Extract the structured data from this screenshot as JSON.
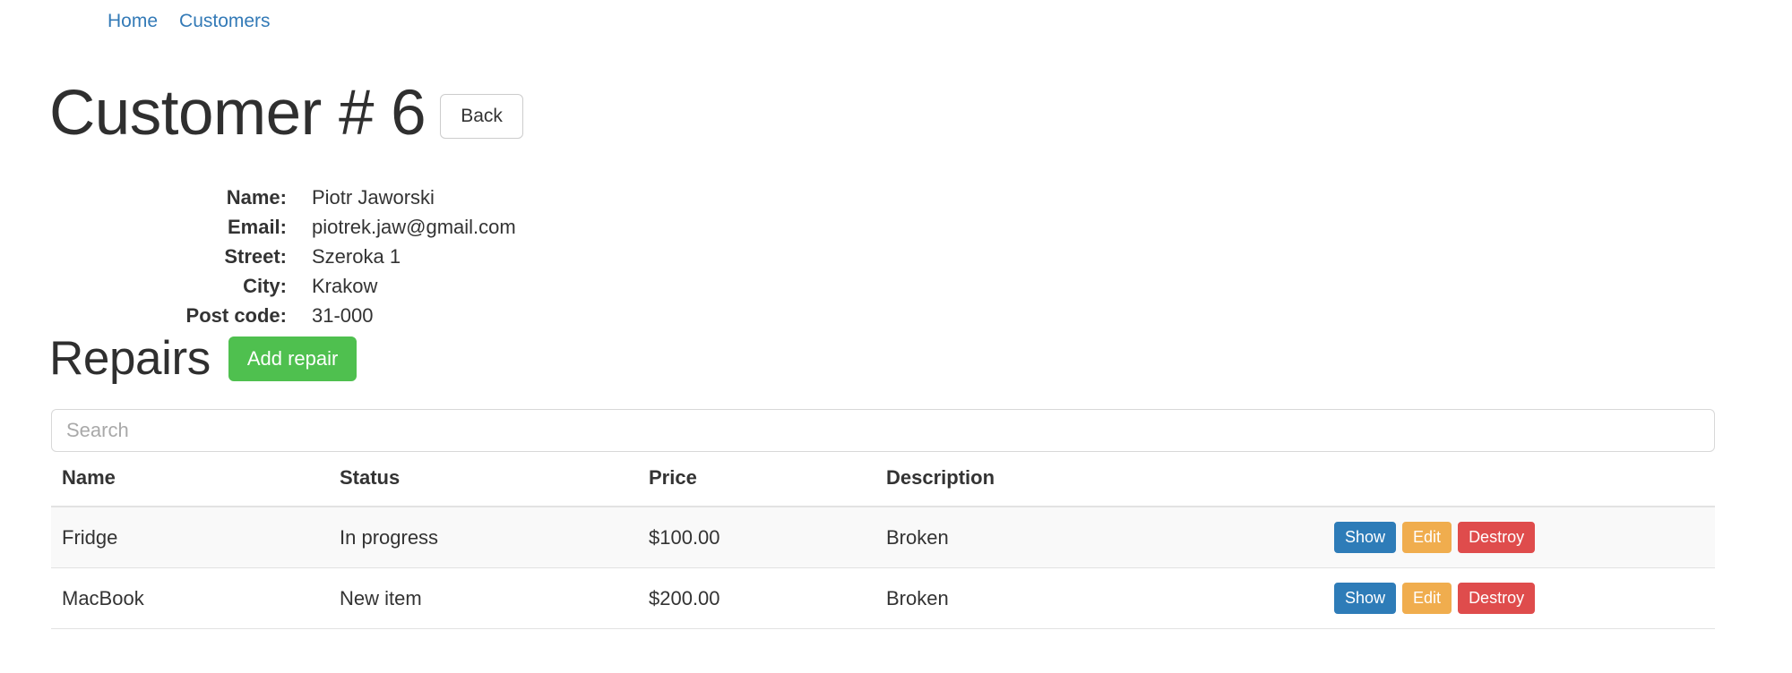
{
  "nav": {
    "links": [
      {
        "label": "Home"
      },
      {
        "label": "Customers"
      }
    ]
  },
  "header": {
    "title": "Customer # 6",
    "back_label": "Back"
  },
  "details": {
    "rows": [
      {
        "term": "Name:",
        "value": "Piotr Jaworski"
      },
      {
        "term": "Email:",
        "value": "piotrek.jaw@gmail.com"
      },
      {
        "term": "Street:",
        "value": "Szeroka 1"
      },
      {
        "term": "City:",
        "value": "Krakow"
      },
      {
        "term": "Post code:",
        "value": "31-000"
      }
    ]
  },
  "repairs": {
    "title": "Repairs",
    "add_label": "Add repair",
    "search": {
      "placeholder": "Search",
      "value": ""
    },
    "columns": [
      {
        "label": "Name"
      },
      {
        "label": "Status"
      },
      {
        "label": "Price"
      },
      {
        "label": "Description"
      },
      {
        "label": ""
      }
    ],
    "rows": [
      {
        "name": "Fridge",
        "status": "In progress",
        "price": "$100.00",
        "description": "Broken",
        "actions": {
          "show": "Show",
          "edit": "Edit",
          "destroy": "Destroy"
        }
      },
      {
        "name": "MacBook",
        "status": "New item",
        "price": "$200.00",
        "description": "Broken",
        "actions": {
          "show": "Show",
          "edit": "Edit",
          "destroy": "Destroy"
        }
      }
    ]
  },
  "colors": {
    "link": "#337ab7",
    "add_button": "#4fc04f",
    "show_button": "#2e7cb8",
    "edit_button": "#f0ad4e",
    "destroy_button": "#df4c4c",
    "row_stripe": "#f9f9f9",
    "border": "#e2e2e2"
  }
}
